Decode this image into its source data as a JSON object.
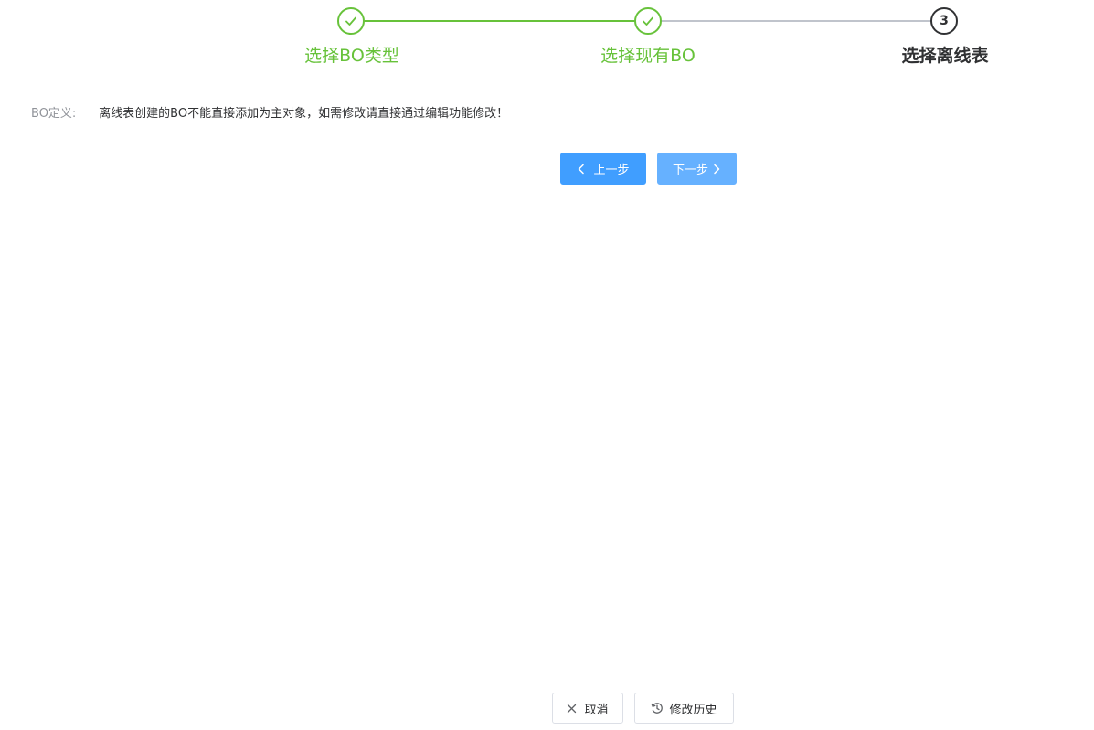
{
  "steps": [
    {
      "label": "选择BO类型",
      "status": "finished"
    },
    {
      "label": "选择现有BO",
      "status": "finished"
    },
    {
      "label": "选择离线表",
      "status": "process",
      "number": "3"
    }
  ],
  "colors": {
    "success": "#67c23a",
    "primary": "#409eff",
    "primary_light": "#66b1ff",
    "inactive_line": "#c0c4cc",
    "text": "#303133",
    "label": "#909399"
  },
  "bo_definition": {
    "label": "BO定义:",
    "text": "离线表创建的BO不能直接添加为主对象，如需修改请直接通过编辑功能修改！"
  },
  "nav": {
    "prev_label": "上一步",
    "next_label": "下一步",
    "prev_icon": "chevron-left-icon",
    "next_icon": "chevron-right-icon"
  },
  "footer": {
    "cancel_label": "取消",
    "cancel_icon": "close-icon",
    "history_label": "修改历史",
    "history_icon": "history-icon"
  }
}
